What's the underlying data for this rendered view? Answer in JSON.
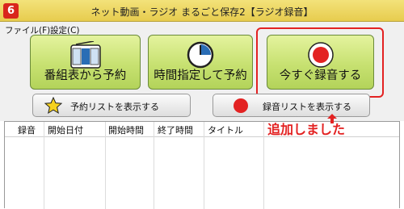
{
  "window": {
    "title": "ネット動画・ラジオ まるごと保存2【ラジオ録音】",
    "icon": "app-logo-icon"
  },
  "menu": {
    "items": [
      "ファイル(F)",
      "設定(C)"
    ]
  },
  "buttons": {
    "program": {
      "label": "番組表から予約",
      "icon": "radio-icon"
    },
    "time": {
      "label": "時間指定して予約",
      "icon": "clock-icon"
    },
    "record": {
      "label": "今すぐ録音する",
      "icon": "record-icon"
    }
  },
  "small_buttons": {
    "reservations": {
      "label": "予約リストを表示する",
      "icon": "star-icon"
    },
    "recordings": {
      "label": "録音リストを表示する",
      "icon": "red-circle-icon"
    }
  },
  "list": {
    "columns": [
      "録音",
      "開始日付",
      "開始時間",
      "終了時間",
      "タイトル"
    ]
  },
  "annotation": {
    "text": "追加しました",
    "color": "#e32222"
  },
  "colors": {
    "titlebar": "#ecd65e",
    "button_green": "#c7e171",
    "record_red": "#e32222"
  }
}
